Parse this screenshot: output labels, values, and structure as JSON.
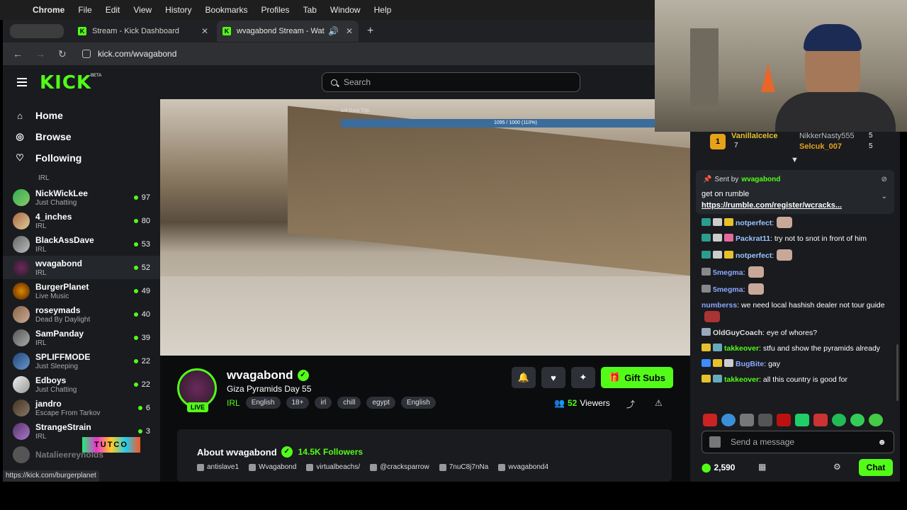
{
  "menubar": {
    "app": "Chrome",
    "items": [
      "File",
      "Edit",
      "View",
      "History",
      "Bookmarks",
      "Profiles",
      "Tab",
      "Window",
      "Help"
    ]
  },
  "tabs": [
    {
      "title": "Stream - Kick Dashboard"
    },
    {
      "title": "wvagabond Stream - Wat"
    }
  ],
  "address": {
    "url": "kick.com/wvagabond"
  },
  "header": {
    "logo": "KICK",
    "beta": "BETA",
    "search_placeholder": "Search"
  },
  "sidebar": {
    "nav": [
      {
        "label": "Home",
        "icon": "home-icon"
      },
      {
        "label": "Browse",
        "icon": "browse-icon"
      },
      {
        "label": "Following",
        "icon": "heart-icon"
      }
    ],
    "partial_category": "IRL",
    "channels": [
      {
        "name": "NickWickLee",
        "category": "Just Chatting",
        "viewers": "97"
      },
      {
        "name": "4_inches",
        "category": "IRL",
        "viewers": "80"
      },
      {
        "name": "BlackAssDave",
        "category": "IRL",
        "viewers": "53"
      },
      {
        "name": "wvagabond",
        "category": "IRL",
        "viewers": "52"
      },
      {
        "name": "BurgerPlanet",
        "category": "Live Music",
        "viewers": "49"
      },
      {
        "name": "roseymads",
        "category": "Dead By Daylight",
        "viewers": "40"
      },
      {
        "name": "SamPanday",
        "category": "IRL",
        "viewers": "39"
      },
      {
        "name": "SPLIFFMODE",
        "category": "Just Sleeping",
        "viewers": "22"
      },
      {
        "name": "Edboys",
        "category": "Just Chatting",
        "viewers": "22"
      },
      {
        "name": "jandro",
        "category": "Escape From Tarkov",
        "viewers": "6"
      },
      {
        "name": "StrangeStrain",
        "category": "IRL",
        "viewers": "3"
      },
      {
        "name": "Natalieereynolds",
        "category": "",
        "viewers": ""
      }
    ],
    "status_url": "https://kick.com/burgerplanet",
    "overlay_text": "TUTCO"
  },
  "video": {
    "goal_label": "1/4 Euro Trip",
    "goal_progress": "1095 / 1000 (110%)"
  },
  "stream": {
    "name": "wvagabond",
    "live": "LIVE",
    "title": "Giza Pyramids Day 55",
    "category": "IRL",
    "tags": [
      "English",
      "18+",
      "irl",
      "chill",
      "egypt",
      "English"
    ],
    "viewers_count": "52",
    "viewers_label": "Viewers",
    "gift_label": "Gift Subs"
  },
  "about": {
    "title": "About wvagabond",
    "followers": "14.5K Followers",
    "socials": [
      "antislave1",
      "Wvagabond",
      "virtualbeachs/",
      "@cracksparrow",
      "7nuC8j7nNa",
      "wvagabond4"
    ]
  },
  "chat": {
    "leaderboard": {
      "first_rank": "1",
      "first_name": "VanillaIceIce",
      "first_count": "7",
      "second_name": "NikkerNasty555",
      "second_count": "5",
      "third_name": "Selcuk_007",
      "third_count": "5"
    },
    "pinned": {
      "sent_by": "Sent by",
      "by_user": "wvagabond",
      "message": "get on rumble",
      "link": "https://rumble.com/register/wcracks..."
    },
    "messages": [
      {
        "user": "notperfect",
        "color": "#3d8bff",
        "text": ":",
        "emote": true
      },
      {
        "user": "Packrat11",
        "color": "#3d8bff",
        "text": ": try not to snot in front of him",
        "emote": false
      },
      {
        "user": "notperfect",
        "color": "#3d8bff",
        "text": ":",
        "emote": true
      },
      {
        "user": "5megma",
        "color": "#3d8bff",
        "text": ":",
        "emote": true
      },
      {
        "user": "5megma",
        "color": "#3d8bff",
        "text": ":",
        "emote": true
      },
      {
        "user": "numberss",
        "color": "#3d8bff",
        "text": ": we need local hashish dealer not tour guide",
        "emote": true
      },
      {
        "user": "OldGuyCoach",
        "color": "#e6c12b",
        "text": ": eye of whores?",
        "emote": false
      },
      {
        "user": "takkeover",
        "color": "#e6c12b",
        "text": ": stfu and show the pyramids already",
        "emote": false
      },
      {
        "user": "BugBite",
        "color": "#3d8bff",
        "text": ": gay",
        "emote": false
      },
      {
        "user": "takkeover",
        "color": "#e6c12b",
        "text": ": all this country is good for",
        "emote": false
      }
    ],
    "input_placeholder": "Send a message",
    "points": "2,590",
    "chat_button": "Chat"
  },
  "colors": {
    "accent": "#53fc18",
    "bg": "#191b1f"
  }
}
